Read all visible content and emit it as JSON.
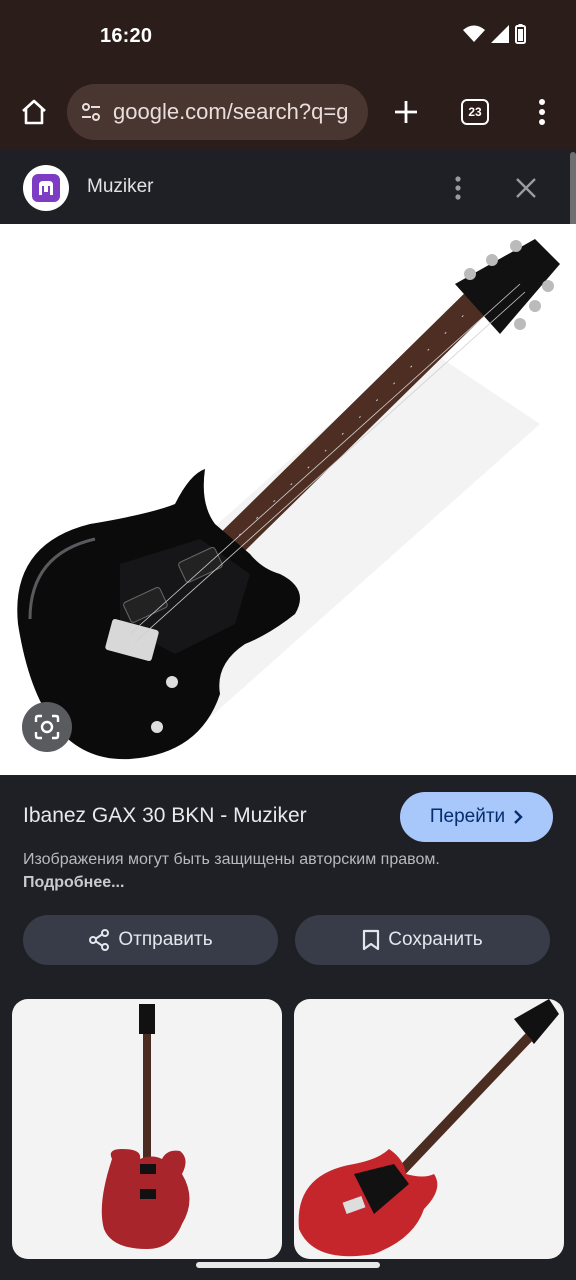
{
  "status_bar": {
    "time": "16:20",
    "icons": [
      "wifi-icon",
      "signal-icon",
      "battery-icon"
    ]
  },
  "browser": {
    "url": "google.com/search?q=g",
    "tab_count": "23",
    "icons": [
      "home-icon",
      "tune-icon",
      "plus-icon",
      "more-vert-icon"
    ]
  },
  "source": {
    "name": "Muziker",
    "icons": [
      "more-vert-icon",
      "close-icon"
    ]
  },
  "result": {
    "title": "Ibanez GAX 30 BKN - Muziker",
    "visit_label": "Перейти",
    "copyright_notice": "Изображения могут быть защищены авторским правом.",
    "learn_more": "Подробнее...",
    "share_label": "Отправить",
    "save_label": "Сохранить"
  },
  "colors": {
    "browser_bar": "#2a1d1a",
    "panel_background": "#1f2025",
    "visit_button": "#a8c7fa",
    "secondary_button": "#373c48",
    "brand": "#7e3cc4"
  }
}
